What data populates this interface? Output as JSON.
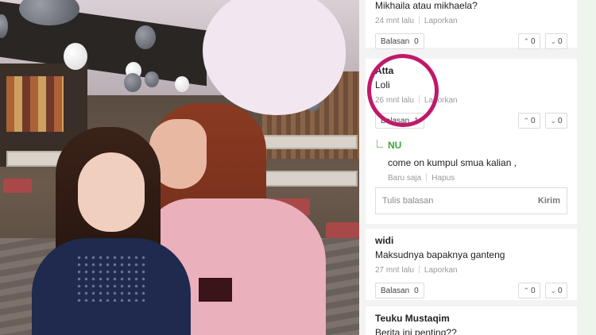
{
  "comments": [
    {
      "text": "Mikhaila atau mikhaela?",
      "time": "24 mnt lalu",
      "report": "Laporkan",
      "reply_label": "Balasan",
      "reply_count": "0",
      "up": "0",
      "down": "0"
    },
    {
      "name": "Atta",
      "text": "Loli",
      "time": "26 mnt lalu",
      "report": "Laporkan",
      "reply_label": "Balasan",
      "reply_count": "1",
      "up": "0",
      "down": "0"
    },
    {
      "name": "widi",
      "text": "Maksudnya bapaknya ganteng",
      "time": "27 mnt lalu",
      "report": "Laporkan",
      "reply_label": "Balasan",
      "reply_count": "0",
      "up": "0",
      "down": "0"
    },
    {
      "name": "Teuku Mustaqim",
      "text": "Berita ini penting??"
    }
  ],
  "reply": {
    "name": "NU",
    "text": "come on kumpul smua kalian ,",
    "time": "Baru saja",
    "delete": "Hapus"
  },
  "reply_input": {
    "placeholder": "Tulis balasan",
    "send_label": "Kirim"
  },
  "colors": {
    "highlight_circle": "#c2186a",
    "reply_name": "#3aa53a"
  }
}
